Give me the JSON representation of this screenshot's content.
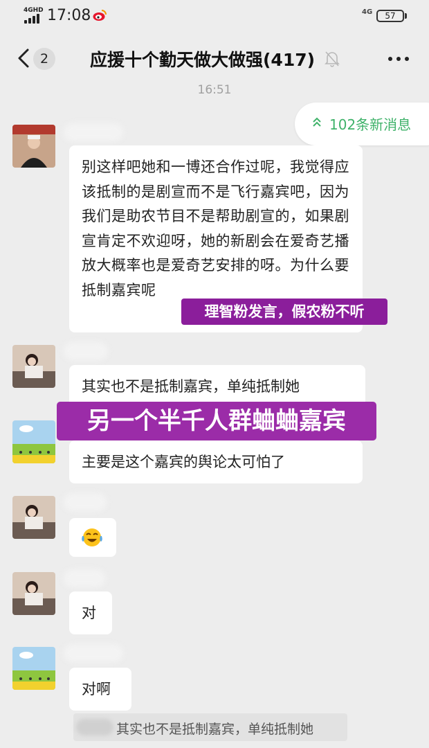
{
  "status_bar": {
    "signal_label": "4GHD",
    "time": "17:08",
    "network_label": "4G",
    "battery_level": "57"
  },
  "header": {
    "back_unread_count": "2",
    "group_title": "应援十个勤天做大做强(417)"
  },
  "timestamp": "16:51",
  "new_messages_pill": "102条新消息",
  "messages": [
    {
      "text": "别这样吧她和一博还合作过呢，我觉得应该抵制的是剧宣而不是飞行嘉宾吧，因为我们是助农节目不是帮助剧宣的，如果剧宣肯定不欢迎呀，她的新剧会在爱奇艺播放大概率也是爱奇艺安排的呀。为什么要抵制嘉宾呢",
      "annotation": "理智粉发言，假农粉不听"
    },
    {
      "text": "其实也不是抵制嘉宾，单纯抵制她",
      "annotation": "另一个半千人群蛐蛐嘉宾"
    },
    {
      "text": "主要是这个嘉宾的舆论太可怕了"
    },
    {
      "emoji": "crying-laughing-face"
    },
    {
      "text": "对"
    },
    {
      "text": "对啊"
    }
  ],
  "quoted_message": "其实也不是抵制嘉宾，单纯抵制她",
  "colors": {
    "chat_background": "#ededed",
    "bubble": "#ffffff",
    "highlight_purple": "#8b1e9b",
    "new_message_green": "#3fb26a"
  }
}
